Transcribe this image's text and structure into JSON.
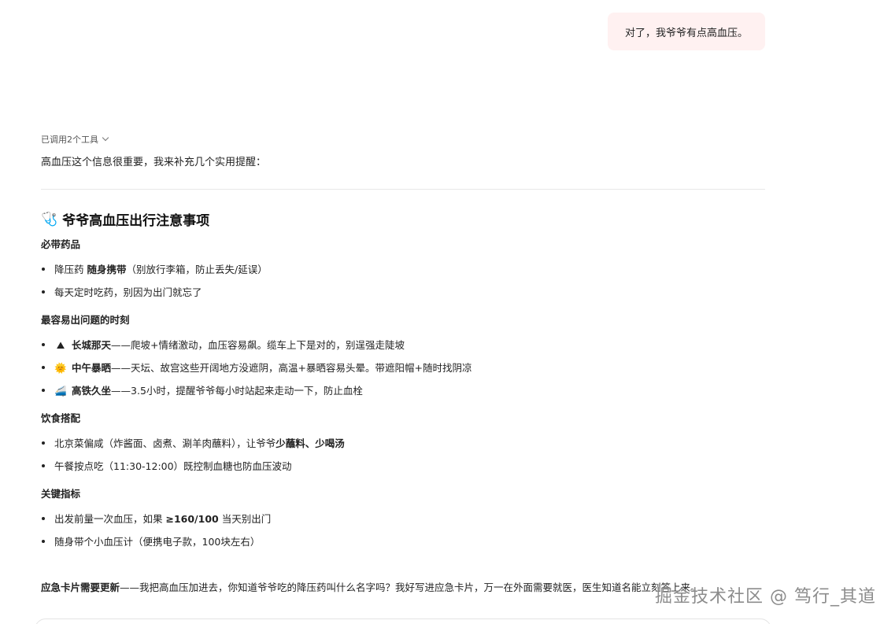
{
  "user_message": "对了，我爷爷有点高血压。",
  "tool_summary": "已调用2个工具",
  "intro": "高血压这个信息很重要，我来补充几个实用提醒：",
  "section": {
    "icon": "stethoscope-icon",
    "icon_glyph": "🩺",
    "title": "爷爷高血压出行注意事项"
  },
  "groups": [
    {
      "title": "必带药品",
      "items": [
        {
          "prefix": "降压药 ",
          "bold": "随身携带",
          "rest": "（别放行李箱，防止丢失/延误）"
        },
        {
          "prefix": "每天定时吃药，别因为出门就忘了",
          "bold": "",
          "rest": ""
        }
      ]
    },
    {
      "title": "最容易出问题的时刻",
      "items": [
        {
          "icon": "mountain-icon",
          "glyph": "⛰",
          "bold": "长城那天",
          "rest": "——爬坡+情绪激动，血压容易飙。缆车上下是对的，别逞强走陡坡"
        },
        {
          "icon": "sun-icon",
          "glyph": "🌞",
          "bold": "中午暴晒",
          "rest": "——天坛、故宫这些开阔地方没遮阴，高温+暴晒容易头晕。带遮阳帽+随时找阴凉"
        },
        {
          "icon": "train-icon",
          "glyph": "🚄",
          "bold": "高铁久坐",
          "rest": "——3.5小时，提醒爷爷每小时站起来走动一下，防止血栓"
        }
      ]
    },
    {
      "title": "饮食搭配",
      "items": [
        {
          "prefix": "北京菜偏咸（炸酱面、卤煮、涮羊肉蘸料），让爷爷",
          "bold": "少蘸料、少喝汤",
          "rest": ""
        },
        {
          "prefix": "午餐按点吃（11:30-12:00）既控制血糖也防血压波动",
          "bold": "",
          "rest": ""
        }
      ]
    },
    {
      "title": "关键指标",
      "items": [
        {
          "prefix": "出发前量一次血压，如果 ",
          "bold": "≥160/100",
          "rest": " 当天别出门"
        },
        {
          "prefix": "随身带个小血压计（便携电子款，100块左右）",
          "bold": "",
          "rest": ""
        }
      ]
    }
  ],
  "final": {
    "bold": "应急卡片需要更新",
    "rest": "——我把高血压加进去，你知道爷爷吃的降压药叫什么名字吗？我好写进应急卡片，万一在外面需要就医，医生知道名能立刻答上来。"
  },
  "watermark": "掘金技术社区 @ 笃行_其道"
}
